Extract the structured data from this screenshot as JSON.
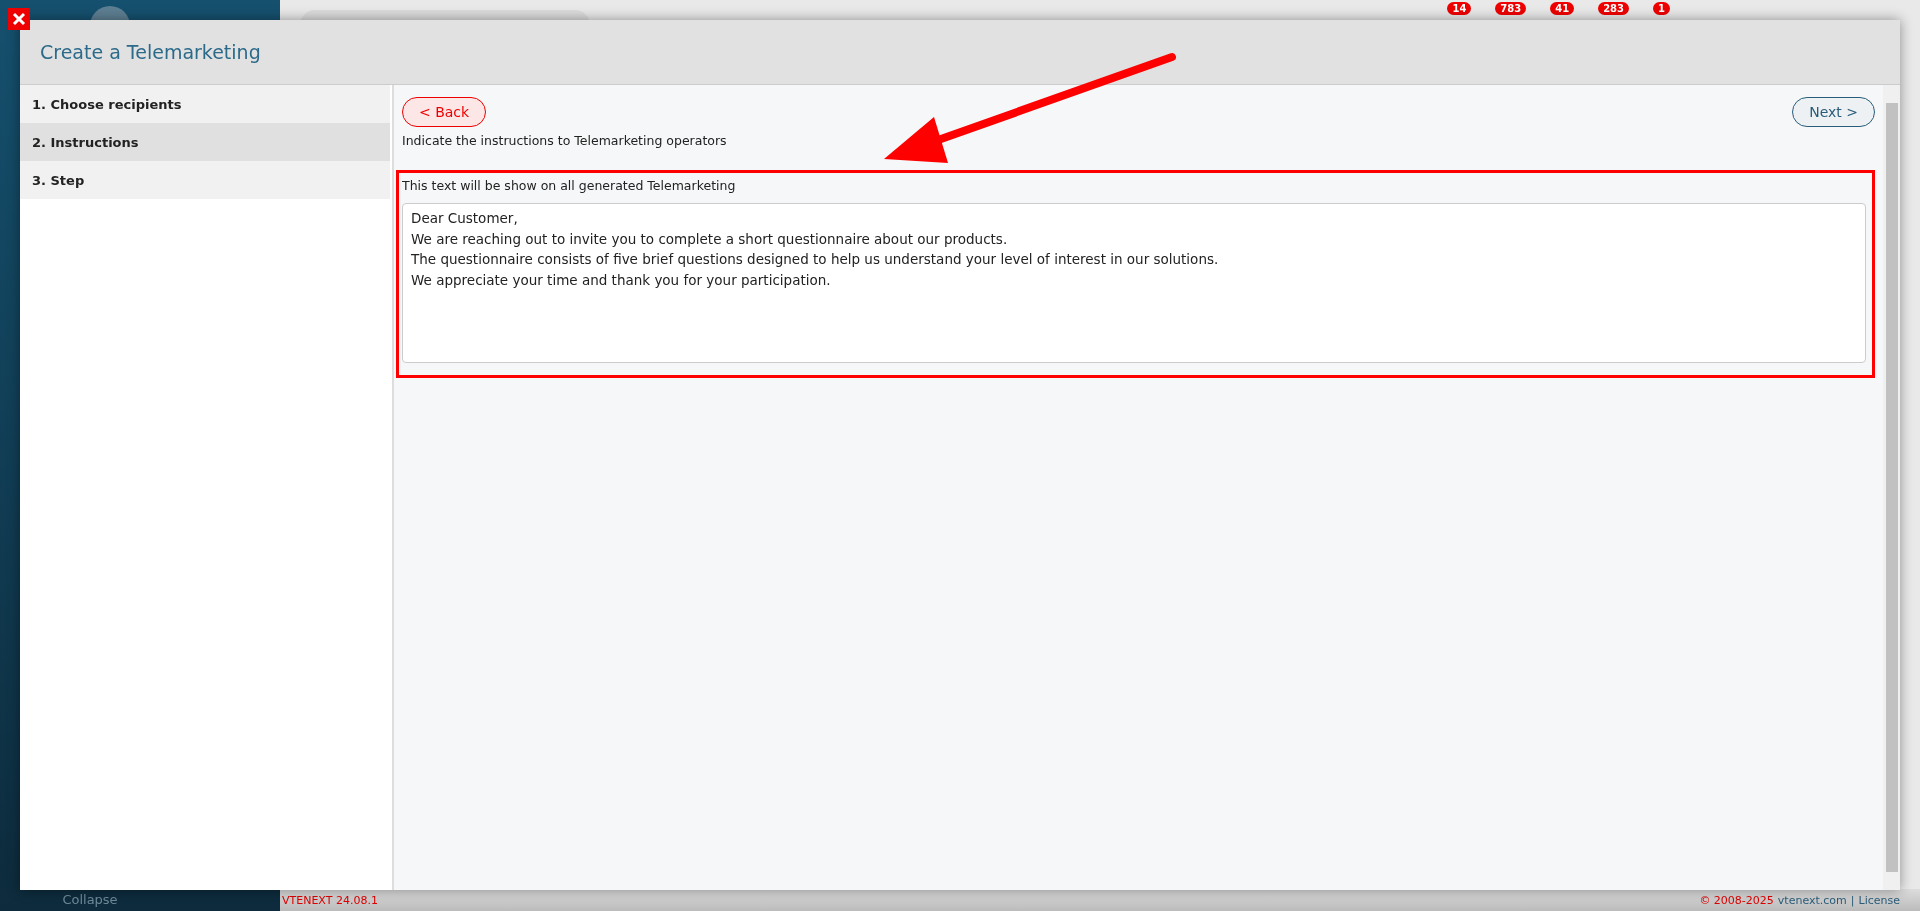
{
  "top_bar": {
    "badges": [
      "14",
      "783",
      "41",
      "283",
      "1"
    ]
  },
  "sidebar": {
    "collapse_label": "Collapse"
  },
  "modal": {
    "title": "Create a Telemarketing",
    "steps": [
      {
        "label": "1. Choose recipients",
        "selected": false
      },
      {
        "label": "2. Instructions",
        "selected": true
      },
      {
        "label": "3. Step",
        "selected": false
      }
    ],
    "back_button": "< Back",
    "next_button": "Next >",
    "instruction": "Indicate the instructions to Telemarketing operators",
    "note": "This text will be show on all generated Telemarketing",
    "message": [
      "Dear Customer,",
      "We are reaching out to invite you to complete a short questionnaire about our products.",
      "The questionnaire consists of five brief questions designed to help us understand your level of interest in our solutions.",
      "We appreciate your time and thank you for your participation."
    ]
  },
  "footer": {
    "version": "VTENEXT 24.08.1",
    "copyright": "© 2008-2025",
    "site": "vtenext.com",
    "separator": "|",
    "license": "License"
  }
}
